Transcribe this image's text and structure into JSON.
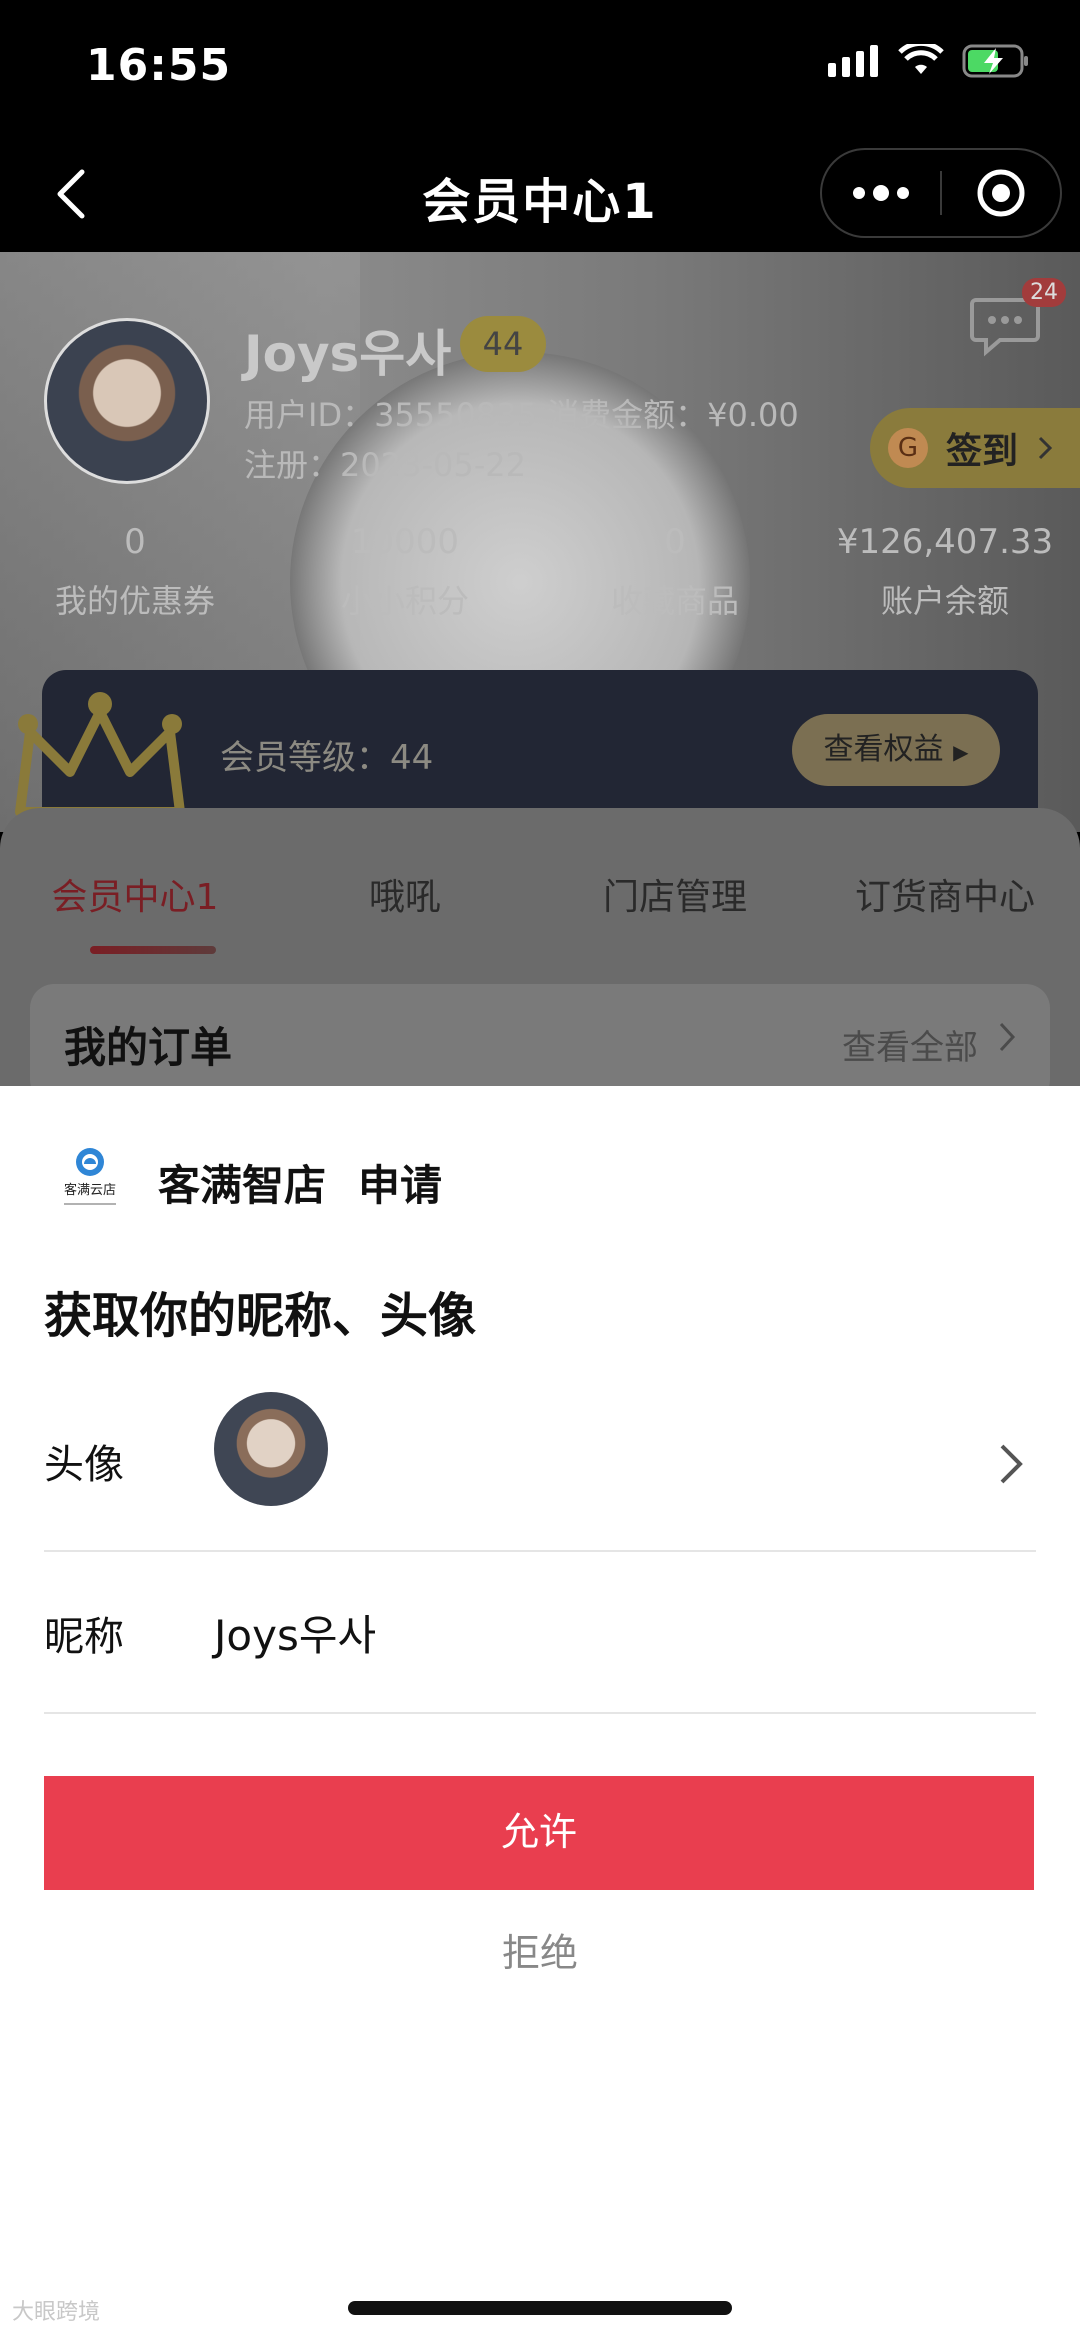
{
  "status": {
    "time": "16:55"
  },
  "nav": {
    "title": "会员中心1"
  },
  "profile": {
    "name": "Joys우사",
    "level_badge": "44",
    "user_id_line": "用户ID：35550835  消费金额：¥0.00",
    "register_line": "注册：2023-05-22",
    "chat_count": "24",
    "signin_icon": "G",
    "signin_label": "签到"
  },
  "stats": [
    {
      "value": "0",
      "label": "我的优惠券"
    },
    {
      "value": "10000",
      "label": "小小积分"
    },
    {
      "value": "0",
      "label": "收藏商品"
    },
    {
      "value": "¥126,407.33",
      "label": "账户余额"
    }
  ],
  "member": {
    "level_text": "会员等级：44",
    "rights_button": "查看权益"
  },
  "tabs": [
    "会员中心1",
    "哦吼",
    "门店管理",
    "订货商中心"
  ],
  "orders": {
    "title": "我的订单",
    "view_all": "查看全部"
  },
  "sheet": {
    "logo_text": "客满云店",
    "app_name": "客满智店",
    "apply": "申请",
    "title": "获取你的昵称、头像",
    "avatar_label": "头像",
    "nickname_label": "昵称",
    "nickname_value": "Joys우사",
    "allow": "允许",
    "reject": "拒绝"
  },
  "watermark": "大眼跨境",
  "colors": {
    "allow_bg": "#e93e4f",
    "active_tab": "#c0262f"
  }
}
